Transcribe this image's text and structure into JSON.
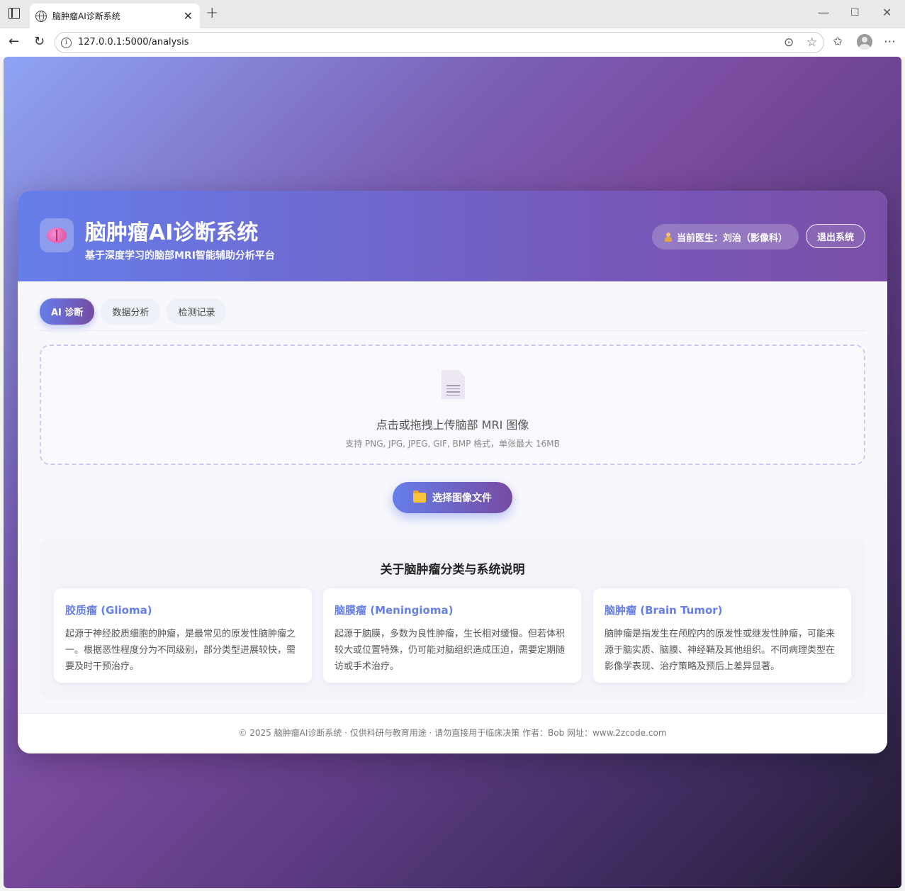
{
  "browser": {
    "tab_title": "脑肿瘤AI诊断系统",
    "url": "127.0.0.1:5000/analysis"
  },
  "header": {
    "title": "脑肿瘤AI诊断系统",
    "subtitle": "基于深度学习的脑部MRI智能辅助分析平台",
    "doctor": "当前医生：刘治（影像科）",
    "logout": "退出系统"
  },
  "tabs": [
    {
      "label": "AI 诊断",
      "active": true
    },
    {
      "label": "数据分析",
      "active": false
    },
    {
      "label": "检测记录",
      "active": false
    }
  ],
  "upload": {
    "title": "点击或拖拽上传脑部 MRI 图像",
    "hint": "支持 PNG, JPG, JPEG, GIF, BMP 格式，单张最大 16MB",
    "button": "选择图像文件"
  },
  "info": {
    "title": "关于脑肿瘤分类与系统说明",
    "cards": [
      {
        "title": "胶质瘤 (Glioma)",
        "text": "起源于神经胶质细胞的肿瘤，是最常见的原发性脑肿瘤之一。根据恶性程度分为不同级别，部分类型进展较快，需要及时干预治疗。"
      },
      {
        "title": "脑膜瘤 (Meningioma)",
        "text": "起源于脑膜，多数为良性肿瘤，生长相对缓慢。但若体积较大或位置特殊，仍可能对脑组织造成压迫，需要定期随访或手术治疗。"
      },
      {
        "title": "脑肿瘤 (Brain Tumor)",
        "text": "脑肿瘤是指发生在颅腔内的原发性或继发性肿瘤，可能来源于脑实质、脑膜、神经鞘及其他组织。不同病理类型在影像学表现、治疗策略及预后上差异显著。"
      }
    ]
  },
  "footer": "© 2025 脑肿瘤AI诊断系统 · 仅供科研与教育用途 · 请勿直接用于临床决策 作者：Bob 网址：www.2zcode.com",
  "colors": {
    "accent_start": "#667eea",
    "accent_end": "#764ba2",
    "card_title": "#667eea"
  }
}
